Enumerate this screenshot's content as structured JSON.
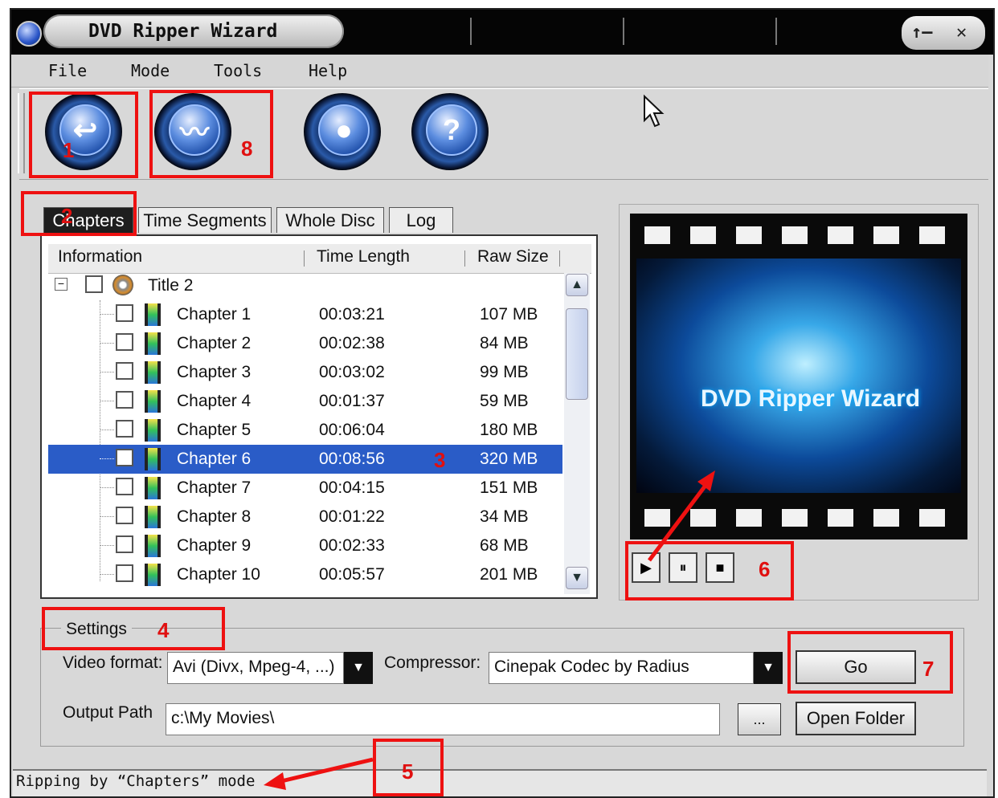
{
  "window": {
    "title": "DVD Ripper Wizard",
    "min_icon": "↑—",
    "close_icon": "✕"
  },
  "menu": [
    "File",
    "Mode",
    "Tools",
    "Help"
  ],
  "toolbar": {
    "buttons": [
      {
        "icon": "disc-open-icon",
        "glyph": "↩"
      },
      {
        "icon": "wizard-icon",
        "glyph": "〰"
      },
      {
        "icon": "settings-disc-icon",
        "glyph": "●"
      },
      {
        "icon": "help-icon",
        "glyph": "?"
      }
    ]
  },
  "tabs": [
    "Chapters",
    "Time Segments",
    "Whole Disc",
    "Log"
  ],
  "list": {
    "columns": [
      "Information",
      "Time Length",
      "Raw Size"
    ],
    "title_node": "Title 2",
    "rows": [
      {
        "name": "Chapter 1",
        "time": "00:03:21",
        "size": "107 MB"
      },
      {
        "name": "Chapter 2",
        "time": "00:02:38",
        "size": "84 MB"
      },
      {
        "name": "Chapter 3",
        "time": "00:03:02",
        "size": "99 MB"
      },
      {
        "name": "Chapter 4",
        "time": "00:01:37",
        "size": "59 MB"
      },
      {
        "name": "Chapter 5",
        "time": "00:06:04",
        "size": "180 MB"
      },
      {
        "name": "Chapter 6",
        "time": "00:08:56",
        "size": "320 MB"
      },
      {
        "name": "Chapter 7",
        "time": "00:04:15",
        "size": "151 MB"
      },
      {
        "name": "Chapter 8",
        "time": "00:01:22",
        "size": "34 MB"
      },
      {
        "name": "Chapter 9",
        "time": "00:02:33",
        "size": "68 MB"
      },
      {
        "name": "Chapter 10",
        "time": "00:05:57",
        "size": "201 MB"
      }
    ]
  },
  "preview": {
    "title": "DVD Ripper Wizard"
  },
  "settings": {
    "group_label": "Settings",
    "video_format_label": "Video format:",
    "video_format_value": "Avi (Divx, Mpeg-4, ...)",
    "compressor_label": "Compressor:",
    "compressor_value": "Cinepak Codec by Radius",
    "output_path_label": "Output Path",
    "output_path_value": "c:\\My Movies\\",
    "browse_label": "...",
    "go_label": "Go",
    "open_folder_label": "Open Folder"
  },
  "status": "Ripping by “Chapters” mode",
  "annotations": [
    "1",
    "2",
    "3",
    "4",
    "5",
    "6",
    "7",
    "8"
  ],
  "colors": {
    "annotation_red": "#ee1111",
    "selection": "#2a5cc7"
  }
}
